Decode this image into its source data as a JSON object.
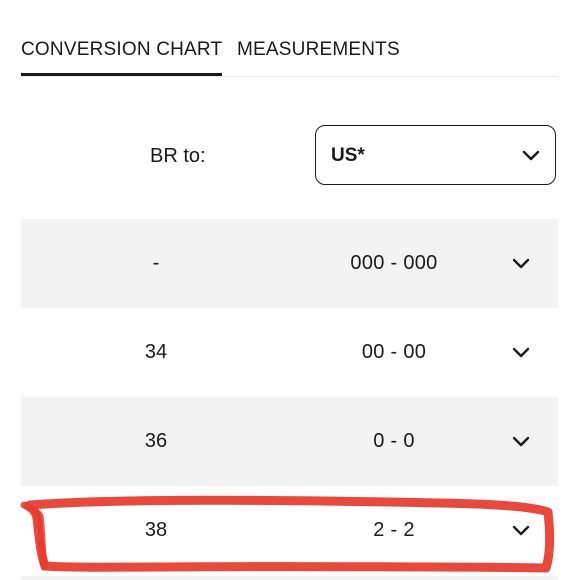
{
  "tabs": [
    {
      "label": "CONVERSION CHART",
      "active": true
    },
    {
      "label": "MEASUREMENTS",
      "active": false
    }
  ],
  "selector": {
    "label": "BR to:",
    "value": "US*"
  },
  "rows": [
    {
      "br": "-",
      "us": "000 - 000"
    },
    {
      "br": "34",
      "us": "00 - 00"
    },
    {
      "br": "36",
      "us": "0 - 0"
    },
    {
      "br": "38",
      "us": "2 - 2",
      "highlighted": true
    }
  ],
  "colors": {
    "text": "#1a1a1a",
    "row_shade": "#f3f3f3",
    "highlight": "#e8382c"
  },
  "icons": {
    "select_chevron": "chevron-down-icon",
    "row_chevron": "chevron-down-icon"
  }
}
